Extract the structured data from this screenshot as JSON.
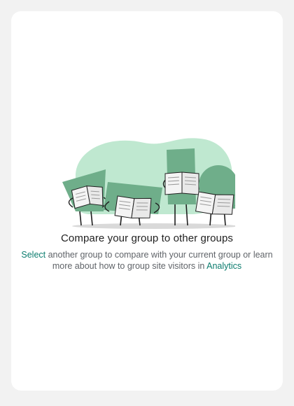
{
  "empty_state": {
    "title": "Compare your group to other groups",
    "select_link": "Select",
    "description_middle": "another group to compare with your current group or learn more about how to group site visitors in",
    "analytics_link": "Analytics"
  },
  "colors": {
    "background": "#f2f2f2",
    "card": "#ffffff",
    "accent_link": "#0b7c6e",
    "blob": "#bfe8d0",
    "figure_green": "#6fae8a",
    "shadow": "#d9d9d9"
  }
}
